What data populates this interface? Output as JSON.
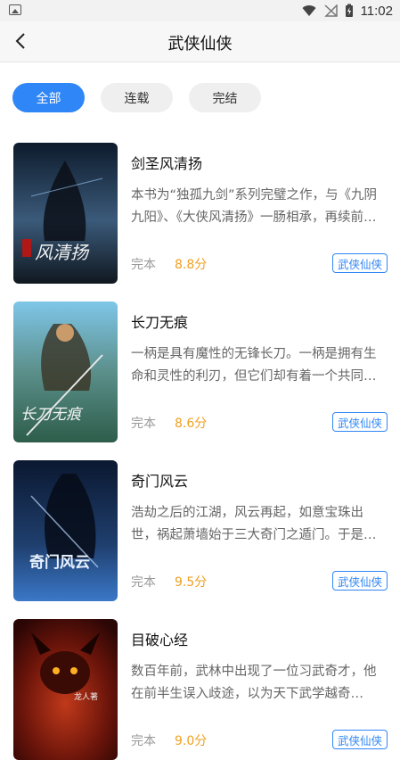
{
  "status_bar": {
    "time": "11:02"
  },
  "header": {
    "title": "武侠仙侠"
  },
  "filters": [
    {
      "label": "全部",
      "active": true
    },
    {
      "label": "连载",
      "active": false
    },
    {
      "label": "完结",
      "active": false
    }
  ],
  "books": [
    {
      "title": "剑圣风清扬",
      "description": "本书为“独孤九剑”系列完璧之作，与《九阴九阳》、《大侠风清扬》一肠相承，再续前缘……",
      "status": "完本",
      "score": "8.8分",
      "tag": "武侠仙侠",
      "cover_text": "风清扬",
      "cover_colors": [
        "#0d1b2c",
        "#3b5a7a"
      ]
    },
    {
      "title": "长刀无痕",
      "description": "一柄是具有魔性的无锋长刀。一柄是拥有生命和灵性的利刃，但它们却有着一个共同的秘密……",
      "status": "完本",
      "score": "8.6分",
      "tag": "武侠仙侠",
      "cover_text": "长刀无痕",
      "cover_colors": [
        "#7fc6e8",
        "#3d6d5a"
      ]
    },
    {
      "title": "奇门风云",
      "description": "浩劫之后的江湖，风云再起，如意宝珠出世，祸起萧墙始于三大奇门之遁门。于是一场风云……",
      "status": "完本",
      "score": "9.5分",
      "tag": "武侠仙侠",
      "cover_text": "奇门风云",
      "cover_colors": [
        "#0b1830",
        "#3a78c8"
      ]
    },
    {
      "title": "目破心经",
      "description": "数百年前，武林中出现了一位习武奇才，他在前半生误入歧途，以为天下武学越奇越……",
      "status": "完本",
      "score": "9.0分",
      "tag": "武侠仙侠",
      "cover_text": "龙人著",
      "cover_colors": [
        "#2a0605",
        "#c0391a"
      ]
    }
  ]
}
